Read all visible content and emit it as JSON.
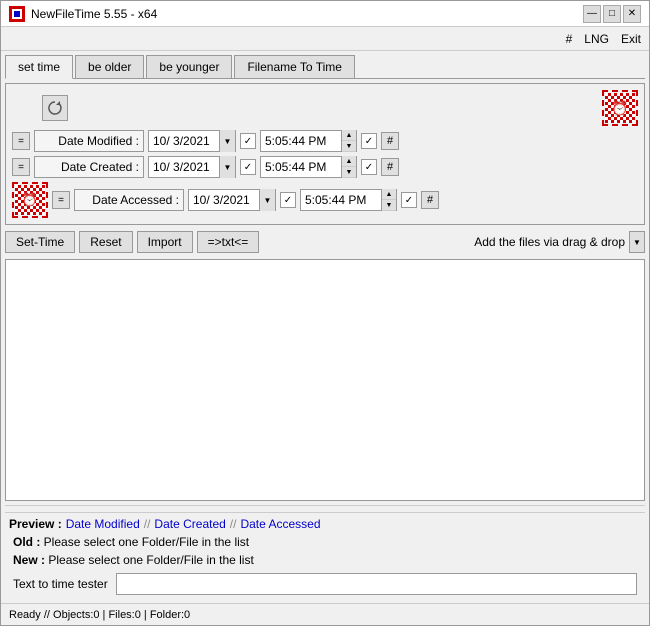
{
  "titleBar": {
    "title": "NewFileTime 5.55 - x64",
    "minimizeLabel": "—",
    "maximizeLabel": "□",
    "closeLabel": "✕"
  },
  "menuBar": {
    "hash": "#",
    "lng": "LNG",
    "exit": "Exit"
  },
  "tabs": [
    {
      "label": "set time",
      "active": true
    },
    {
      "label": "be older",
      "active": false
    },
    {
      "label": "be younger",
      "active": false
    },
    {
      "label": "Filename To Time",
      "active": false
    }
  ],
  "dateRows": [
    {
      "label": "Date Modified :",
      "date": "10/ 3/2021",
      "time": "5:05:44 PM",
      "checked1": true,
      "checked2": true
    },
    {
      "label": "Date Created :",
      "date": "10/ 3/2021",
      "time": "5:05:44 PM",
      "checked1": true,
      "checked2": true
    },
    {
      "label": "Date Accessed :",
      "date": "10/ 3/2021",
      "time": "5:05:44 PM",
      "checked1": true,
      "checked2": true
    }
  ],
  "toolbar": {
    "setTimeLabel": "Set-Time",
    "resetLabel": "Reset",
    "importLabel": "Import",
    "convertLabel": "=>txt<=",
    "dragDropLabel": "Add the files via drag & drop"
  },
  "preview": {
    "label": "Preview :",
    "dateModified": "Date Modified",
    "sep1": "//",
    "dateCreated": "Date Created",
    "sep2": "//",
    "dateAccessed": "Date Accessed",
    "oldLabel": "Old :",
    "oldValue": "Please select one Folder/File in the list",
    "newLabel": "New :",
    "newValue": "Please select one Folder/File in the list",
    "textTesterLabel": "Text to time tester"
  },
  "statusBar": {
    "text": "Ready  //  Objects:0  |  Files:0   |  Folder:0"
  }
}
